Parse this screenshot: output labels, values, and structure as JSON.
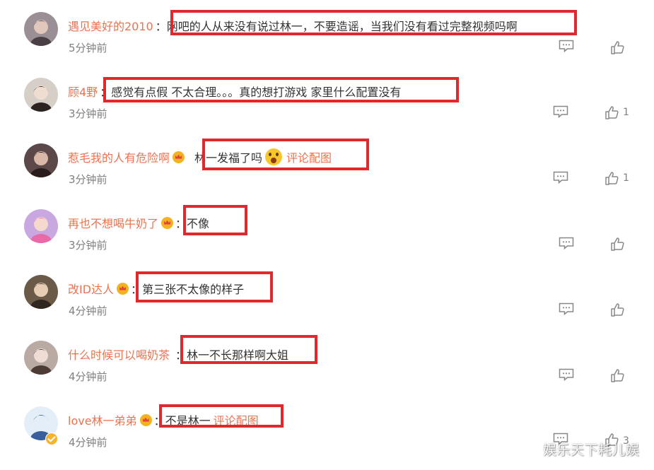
{
  "comments": [
    {
      "username": "遇见美好的2010",
      "vip": false,
      "verified": false,
      "colon": "：",
      "text": "网吧的人从来没有说过林一，不要造谣，当我们没有看过完整视频吗啊",
      "emoji": false,
      "link": "",
      "time": "5分钟前",
      "likes": "",
      "avatar": {
        "bg": "#9a8f95",
        "skin": "#e2c8bc",
        "hair": "#4a3f45"
      }
    },
    {
      "username": "顾4野",
      "vip": false,
      "verified": false,
      "colon": "：",
      "text": "感觉有点假 不太合理。。。真的想打游戏 家里什么配置没有",
      "emoji": false,
      "link": "",
      "time": "3分钟前",
      "likes": "1",
      "avatar": {
        "bg": "#d6cfc7",
        "skin": "#f0ddd2",
        "hair": "#2b2420"
      }
    },
    {
      "username": "惹毛我的人有危险啊",
      "vip": true,
      "verified": false,
      "colon": "",
      "text": "林一发福了吗",
      "emoji": true,
      "link": "评论配图",
      "time": "3分钟前",
      "likes": "1",
      "avatar": {
        "bg": "#5c4848",
        "skin": "#d9b8a8",
        "hair": "#2a1c1c"
      }
    },
    {
      "username": "再也不想喝牛奶了",
      "vip": true,
      "verified": false,
      "colon": "：",
      "text": "不像",
      "emoji": false,
      "link": "",
      "time": "3分钟前",
      "likes": "",
      "avatar": {
        "bg": "#c9a8e2",
        "skin": "#f5d9cf",
        "hair": "#e86aa6"
      }
    },
    {
      "username": "改ID达人",
      "vip": true,
      "verified": false,
      "colon": "：",
      "text": "第三张不太像的样子",
      "emoji": false,
      "link": "",
      "time": "4分钟前",
      "likes": "",
      "avatar": {
        "bg": "#6b5a48",
        "skin": "#e6cdb4",
        "hair": "#2f2620"
      }
    },
    {
      "username": "什么时候可以喝奶茶",
      "vip": false,
      "verified": false,
      "colon": "：",
      "text": "林一不长那样啊大姐",
      "emoji": false,
      "link": "",
      "time": "4分钟前",
      "likes": "",
      "avatar": {
        "bg": "#b9aaa4",
        "skin": "#efdcd4",
        "hair": "#4d3c36"
      }
    },
    {
      "username": "love林一弟弟",
      "vip": true,
      "verified": true,
      "colon": "：",
      "text": "不是林一",
      "emoji": false,
      "link": "评论配图",
      "time": "4分钟前",
      "likes": "3",
      "avatar": {
        "bg": "#e4eef8",
        "skin": "#e4eef8",
        "hair": "#3a5f9e"
      }
    }
  ],
  "watermark": "娱乐天下耗儿娱",
  "colors": {
    "username": "#eb7350",
    "highlight": "#e1282d",
    "meta": "#808080"
  },
  "icons": {
    "reply": "comment-icon",
    "like": "thumb-up-icon"
  }
}
